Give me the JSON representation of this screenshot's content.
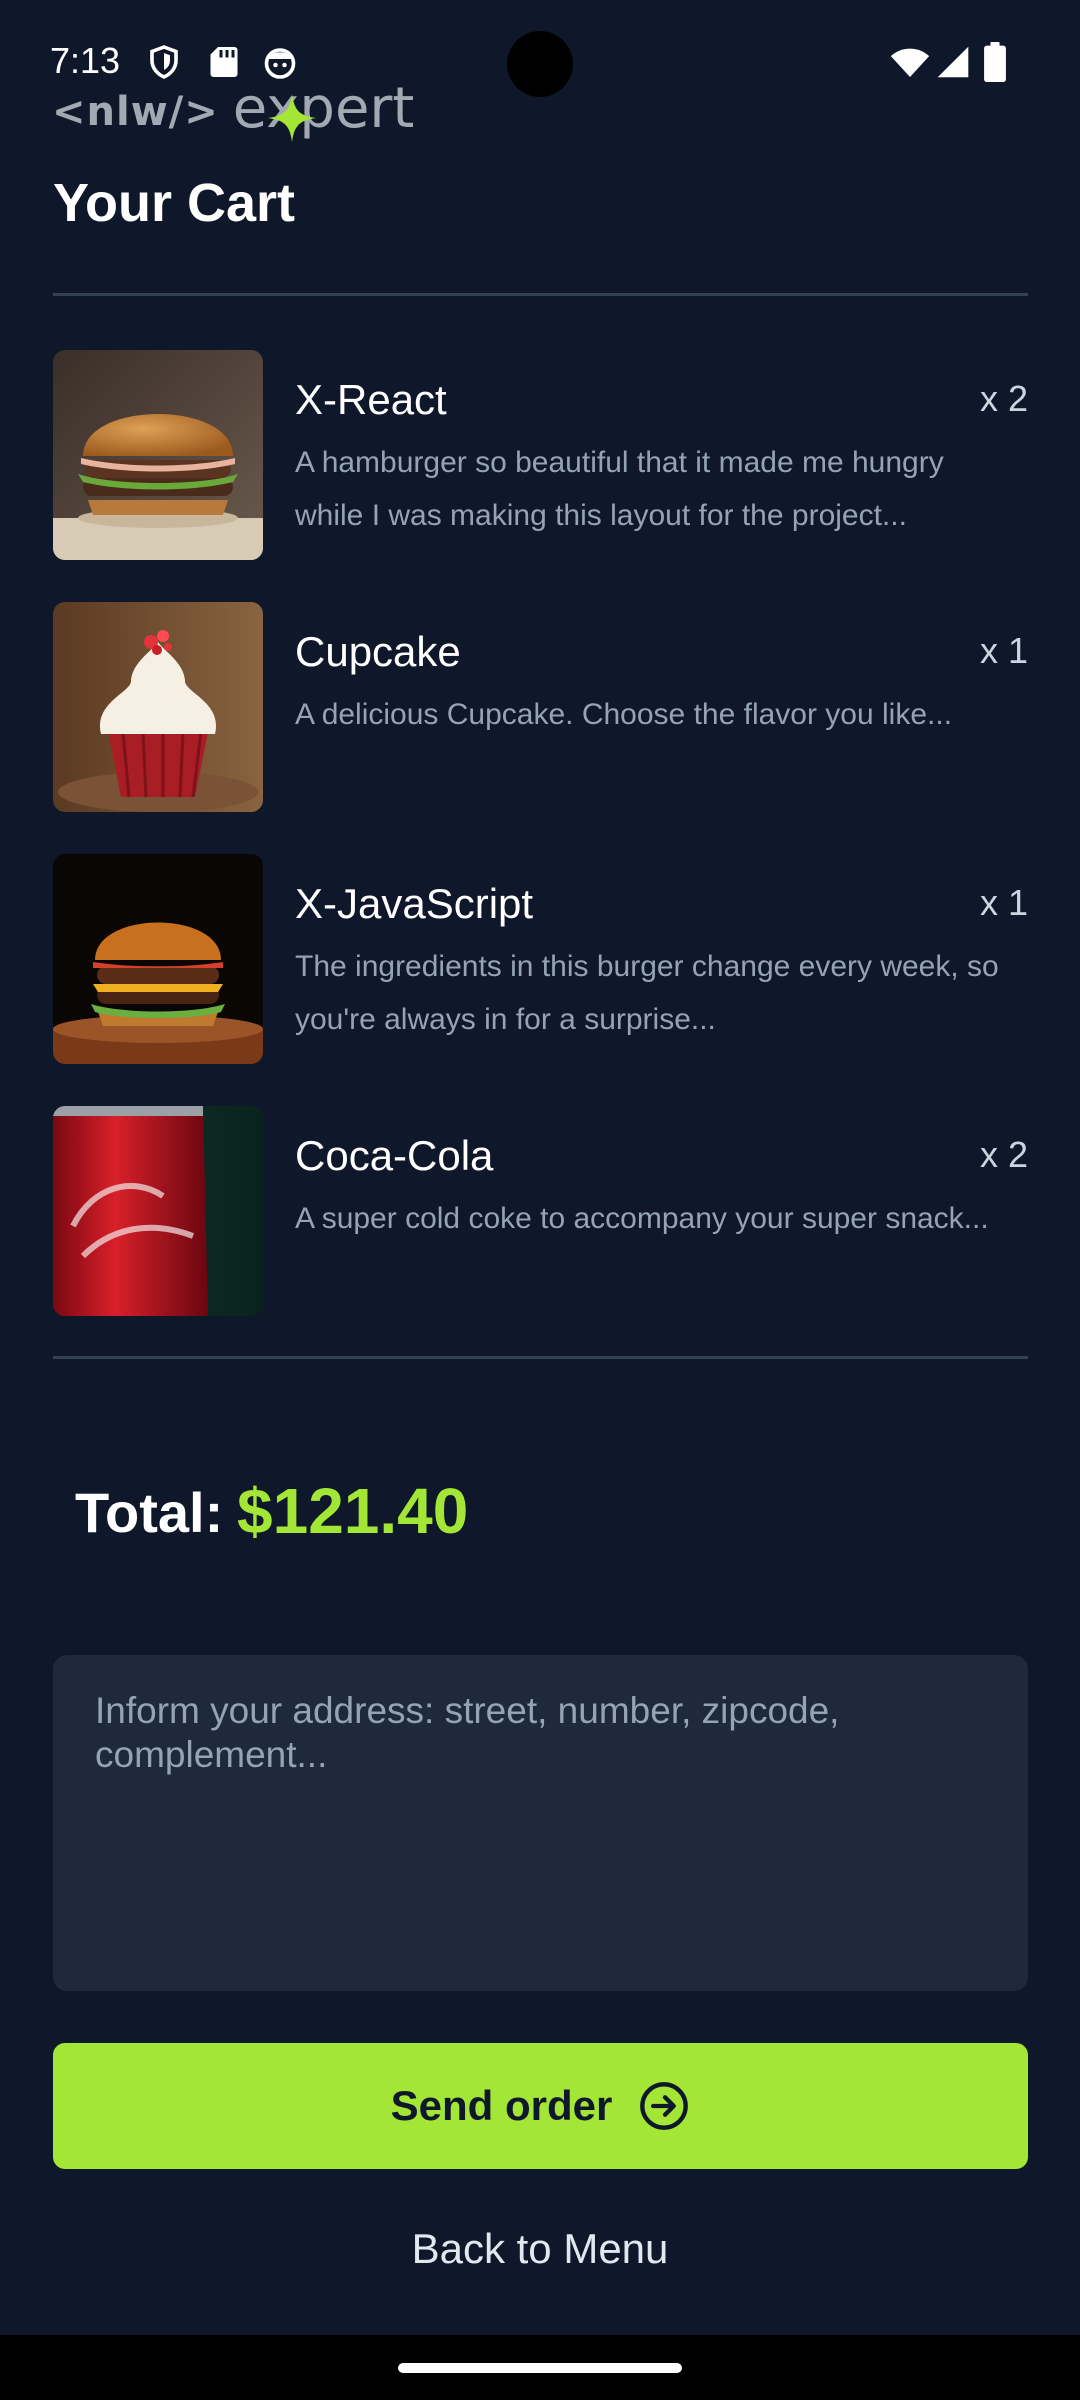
{
  "status_bar": {
    "time": "7:13",
    "left_icons": [
      "shield-icon",
      "sd-card-icon",
      "face-icon"
    ],
    "right_icons": [
      "wifi-icon",
      "signal-icon",
      "battery-icon"
    ]
  },
  "logo": {
    "code": "<nlw/>",
    "text": "expert"
  },
  "page": {
    "title": "Your Cart"
  },
  "cart": {
    "items": [
      {
        "name": "X-React",
        "quantity": "x 2",
        "description": "A hamburger so beautiful that it made me hungry while I was making this layout for the project...",
        "image": "hamburger-image"
      },
      {
        "name": "Cupcake",
        "quantity": "x 1",
        "description": "A delicious Cupcake. Choose the flavor you like...",
        "image": "cupcake-image"
      },
      {
        "name": "X-JavaScript",
        "quantity": "x 1",
        "description": "The ingredients in this burger change every week, so you're always in for a surprise...",
        "image": "burger-image"
      },
      {
        "name": "Coca-Cola",
        "quantity": "x 2",
        "description": "A super cold coke to accompany your super snack...",
        "image": "coke-can-image"
      }
    ]
  },
  "total": {
    "label": "Total:",
    "value": "$121.40"
  },
  "address": {
    "value": "",
    "placeholder": "Inform your address: street, number, zipcode, complement..."
  },
  "actions": {
    "send_label": "Send order",
    "back_label": "Back to Menu"
  },
  "colors": {
    "background": "#0f172a",
    "accent": "#a3e635",
    "input": "#1e293b",
    "divider": "#334155"
  }
}
